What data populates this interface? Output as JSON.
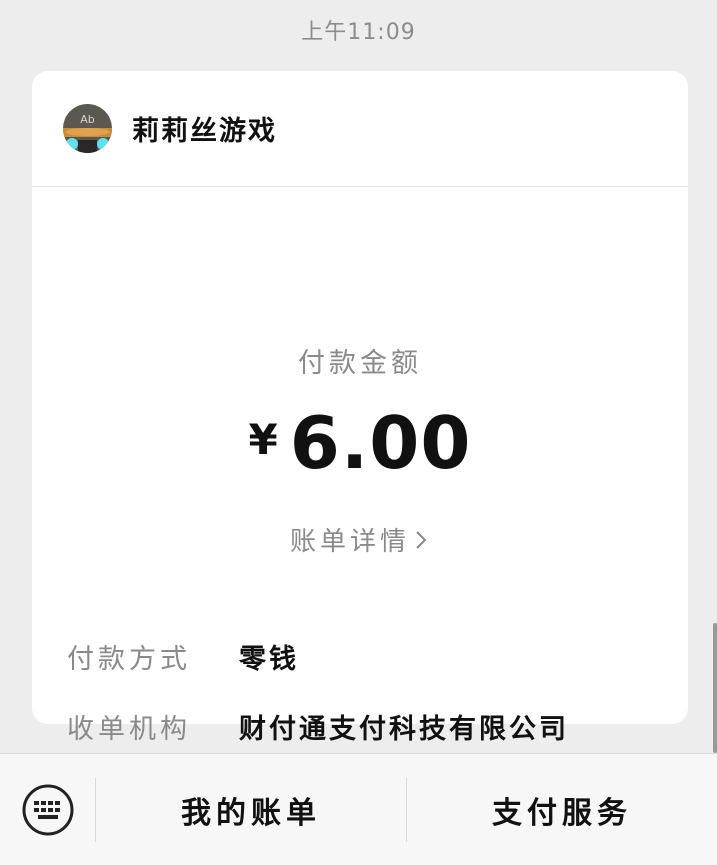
{
  "message": {
    "timestamp": "上午11:09"
  },
  "card": {
    "merchant": {
      "name": "莉莉丝游戏",
      "avatar_icon": "lilith-games-avatar-icon"
    },
    "amount_label": "付款金额",
    "currency_symbol": "¥",
    "amount": "6.00",
    "bill_detail_label": "账单详情",
    "details": [
      {
        "label": "付款方式",
        "value": "零钱"
      },
      {
        "label": "收单机构",
        "value": "财付通支付科技有限公司"
      }
    ]
  },
  "bottom_bar": {
    "keyboard_icon": "keyboard-icon",
    "menu": [
      {
        "label": "我的账单"
      },
      {
        "label": "支付服务"
      }
    ]
  },
  "colors": {
    "background": "#ededed",
    "card": "#ffffff",
    "primary_text": "#111111",
    "secondary_text": "#8a8a8a",
    "bottom_bar": "#f7f7f7"
  }
}
